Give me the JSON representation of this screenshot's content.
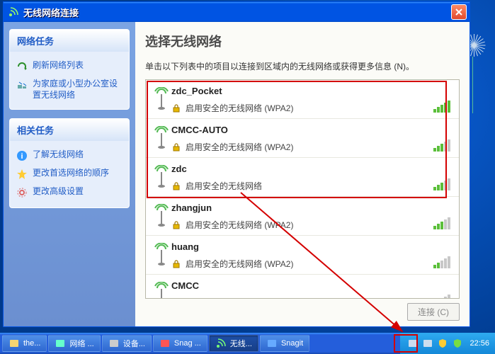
{
  "window": {
    "title": "无线网络连接"
  },
  "sidebar": {
    "group1": {
      "title": "网络任务",
      "items": [
        {
          "label": "刷新网络列表",
          "icon": "refresh"
        },
        {
          "label": "为家庭或小型办公室设置无线网络",
          "icon": "home-net"
        }
      ]
    },
    "group2": {
      "title": "相关任务",
      "items": [
        {
          "label": "了解无线网络",
          "icon": "info"
        },
        {
          "label": "更改首选网络的顺序",
          "icon": "star"
        },
        {
          "label": "更改高级设置",
          "icon": "gear"
        }
      ]
    }
  },
  "main": {
    "heading": "选择无线网络",
    "subtitle": "单击以下列表中的项目以连接到区域内的无线网络或获得更多信息 (N)。",
    "connect_button": "连接 (C)"
  },
  "networks": [
    {
      "ssid": "zdc_Pocket",
      "security": "启用安全的无线网络 (WPA2)",
      "signal": 5
    },
    {
      "ssid": "CMCC-AUTO",
      "security": "启用安全的无线网络 (WPA2)",
      "signal": 3
    },
    {
      "ssid": "zdc",
      "security": "启用安全的无线网络",
      "signal": 3
    },
    {
      "ssid": "zhangjun",
      "security": "启用安全的无线网络 (WPA2)",
      "signal": 3
    },
    {
      "ssid": "huang",
      "security": "启用安全的无线网络 (WPA2)",
      "signal": 2
    },
    {
      "ssid": "CMCC",
      "security": "",
      "signal": 0
    }
  ],
  "taskbar": {
    "items": [
      {
        "label": "the...",
        "icon": "folder"
      },
      {
        "label": "网络 ...",
        "icon": "netplaces"
      },
      {
        "label": "设备...",
        "icon": "device"
      },
      {
        "label": "Snag ...",
        "icon": "snagit-rec"
      },
      {
        "label": "无线...",
        "icon": "wireless",
        "active": true
      },
      {
        "label": "Snagit",
        "icon": "snagit"
      }
    ],
    "tray_icons": [
      "monitor",
      "net",
      "shield-yellow",
      "shield-green"
    ],
    "clock": "22:56"
  }
}
